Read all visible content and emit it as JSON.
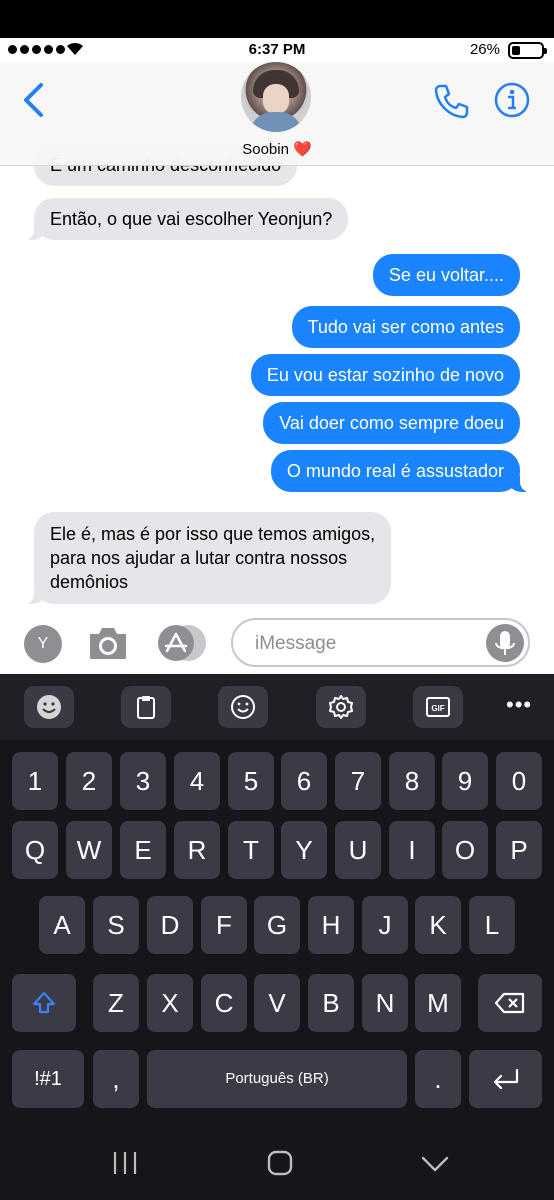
{
  "status": {
    "time": "6:37 PM",
    "battery": "26%"
  },
  "header": {
    "contact_name": "Soobin ❤️",
    "icons": [
      "back-chevron-icon",
      "avatar",
      "phone-icon",
      "info-icon"
    ]
  },
  "messages": [
    {
      "dir": "in",
      "text": "É um caminho desconhecido"
    },
    {
      "dir": "in",
      "text": "Então, o que vai escolher Yeonjun?"
    },
    {
      "dir": "out",
      "text": "Se eu voltar...."
    },
    {
      "dir": "out",
      "text": "Tudo vai ser como antes"
    },
    {
      "dir": "out",
      "text": "Eu vou estar sozinho de novo"
    },
    {
      "dir": "out",
      "text": "Vai doer como sempre doeu"
    },
    {
      "dir": "out",
      "text": "O mundo real é assustador"
    },
    {
      "dir": "in",
      "lines": [
        "Ele é, mas é por isso que temos amigos,",
        "para nos ajudar a lutar contra nossos",
        "demônios"
      ]
    }
  ],
  "input": {
    "app_letter": "Y",
    "placeholder": "iMessage"
  },
  "keyboard": {
    "toolbar": [
      "emoji-icon",
      "clipboard-icon",
      "smiley-icon",
      "settings-icon",
      "gif-icon"
    ],
    "toolbar_more": "•••",
    "gif_label": "GIF",
    "row_numbers": [
      "1",
      "2",
      "3",
      "4",
      "5",
      "6",
      "7",
      "8",
      "9",
      "0"
    ],
    "row_top": [
      "Q",
      "W",
      "E",
      "R",
      "T",
      "Y",
      "U",
      "I",
      "O",
      "P"
    ],
    "row_mid": [
      "A",
      "S",
      "D",
      "F",
      "G",
      "H",
      "J",
      "K",
      "L"
    ],
    "row_bottom": [
      "Z",
      "X",
      "C",
      "V",
      "B",
      "N",
      "M"
    ],
    "symbols_key": "!#1",
    "comma_key": ",",
    "space_label": "Português (BR)",
    "period_key": "."
  },
  "colors": {
    "outgoing": "#1a84ff",
    "incoming": "#e5e5ea",
    "ios_blue": "#1a7cf5",
    "key_bg": "#3a3b47",
    "keyboard_bg": "#15151a"
  }
}
